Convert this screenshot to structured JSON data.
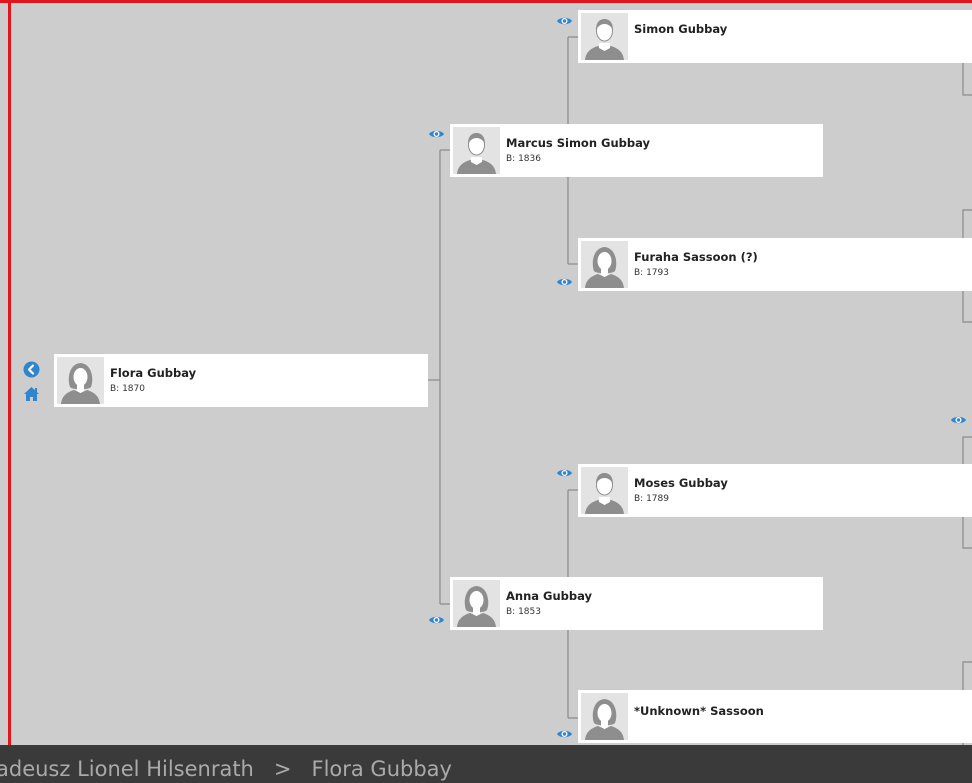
{
  "tree": {
    "root": {
      "name": "Flora Gubbay",
      "birth": "B: 1870",
      "gender": "female"
    },
    "father": {
      "name": "Marcus Simon Gubbay",
      "birth": "B: 1836",
      "gender": "male"
    },
    "mother": {
      "name": "Anna Gubbay",
      "birth": "B: 1853",
      "gender": "female"
    },
    "paternal_grandfather": {
      "name": "Simon Gubbay",
      "birth": "",
      "gender": "male"
    },
    "paternal_grandmother": {
      "name": "Furaha Sassoon (?)",
      "birth": "B: 1793",
      "gender": "female"
    },
    "maternal_grandfather": {
      "name": "Moses Gubbay",
      "birth": "B: 1789",
      "gender": "male"
    },
    "maternal_grandmother": {
      "name": "*Unknown* Sassoon",
      "birth": "",
      "gender": "female"
    }
  },
  "nav": {
    "back_icon": "chevron-left-circle-icon",
    "home_icon": "home-icon",
    "view_icon": "eye-icon"
  },
  "breadcrumb": {
    "items": [
      "adeusz Lionel Hilsenrath",
      "Flora Gubbay"
    ],
    "separator": ">"
  },
  "colors": {
    "background": "#cdcdcd",
    "accent": "#2f86cc",
    "frame": "#e0161c",
    "breadcrumb_bg": "#3a3a3a",
    "breadcrumb_text": "#aaaaaa"
  }
}
